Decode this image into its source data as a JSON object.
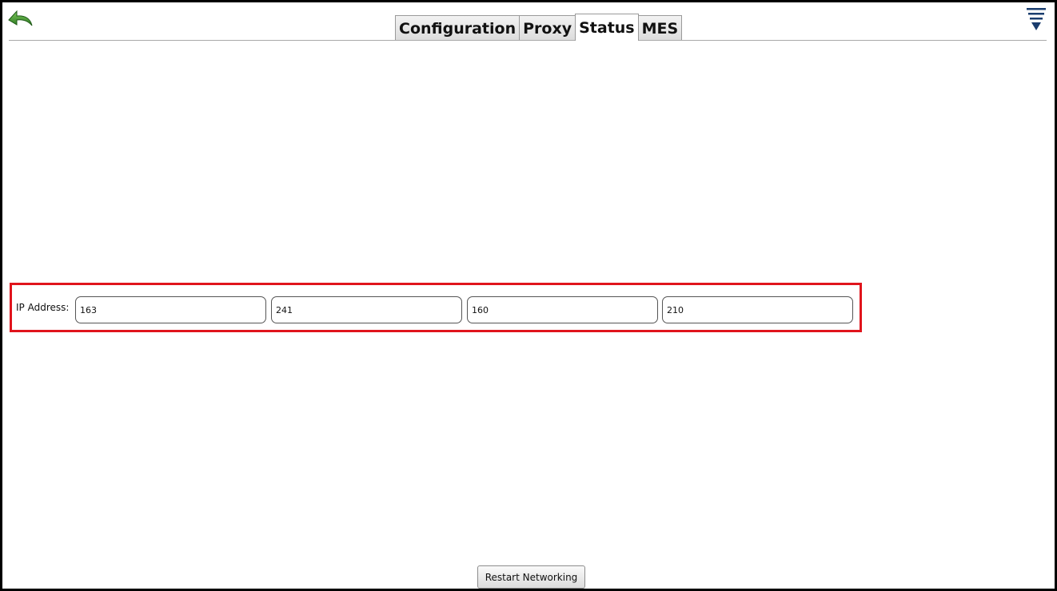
{
  "tabs": [
    {
      "label": "Configuration",
      "active": false
    },
    {
      "label": "Proxy",
      "active": false
    },
    {
      "label": "Status",
      "active": true
    },
    {
      "label": "MES",
      "active": false
    }
  ],
  "toolbar": {
    "back_icon": "back-arrow-icon",
    "menu_icon": "menu-icon"
  },
  "ip_address": {
    "label": "IP Address:",
    "octets": [
      "163",
      "241",
      "160",
      "210"
    ]
  },
  "restart_button": {
    "label": "Restart Networking"
  },
  "colors": {
    "highlight_border": "#e0141c",
    "back_arrow": "#4a9a2e",
    "menu_icon": "#1a3d6e"
  }
}
